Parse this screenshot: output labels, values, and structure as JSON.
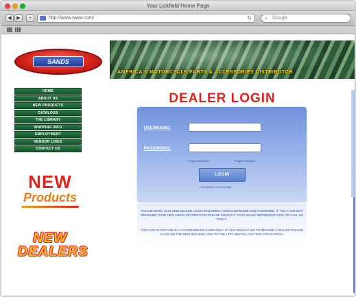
{
  "window": {
    "title": "Your Lickfield Home Page"
  },
  "toolbar": {
    "back_label": "◀",
    "forward_label": "▶",
    "add_label": "+",
    "url": "http://www.www.com/",
    "reload_icon": "↻",
    "search_placeholder": "Google",
    "search_icon": "⌕"
  },
  "header": {
    "logo_text": "SANDS",
    "tagline": "AMERICA'S MOTORCYCLE PARTS & ACCESSORIES DISTRIBUTOR"
  },
  "nav": {
    "items": [
      {
        "label": "HOME"
      },
      {
        "label": "ABOUT US"
      },
      {
        "label": "NEW PRODUCTS"
      },
      {
        "label": "CATALOGS"
      },
      {
        "label": "THE LIBRARY"
      },
      {
        "label": "SHIPPING INFO"
      },
      {
        "label": "EMPLOYMENT"
      },
      {
        "label": "VENDOR LINKS"
      },
      {
        "label": "CONTACT US"
      }
    ]
  },
  "promo": {
    "new_products_line1": "NEW",
    "new_products_line2": "Products",
    "new_dealers_line1": "NEW",
    "new_dealers_line2": "DEALERS"
  },
  "login": {
    "heading": "DEALER LOGIN",
    "username_label": "USERNAME:",
    "password_label": "PASSWORD:",
    "forgot_username": "Forgot Username",
    "forgot_password": "Forgot Password",
    "button_label": "LOGIN",
    "remember_label": "□ Remember me next time"
  },
  "info": {
    "text_1": "PLEASE NOTE: OUR NEW DEALER LOGIN REQUIRES A NEW USERNAME AND PASSWORD. IF YOU HAVE NOT RECEIVED YOUR NEW LOGIN INFORMATION PLEASE CONTACT YOUR SALES REPRESENTATIVE OR CALL US TODAY.",
    "text_2": "THIS SITE IS FOR USE BY AUTHORIZED DEALERS ONLY. IF YOU WOULD LIKE TO BECOME A DEALER PLEASE CLICK ON THE NEW DEALERS LINK TO THE LEFT AND FILL OUT THE APPLICATION."
  }
}
